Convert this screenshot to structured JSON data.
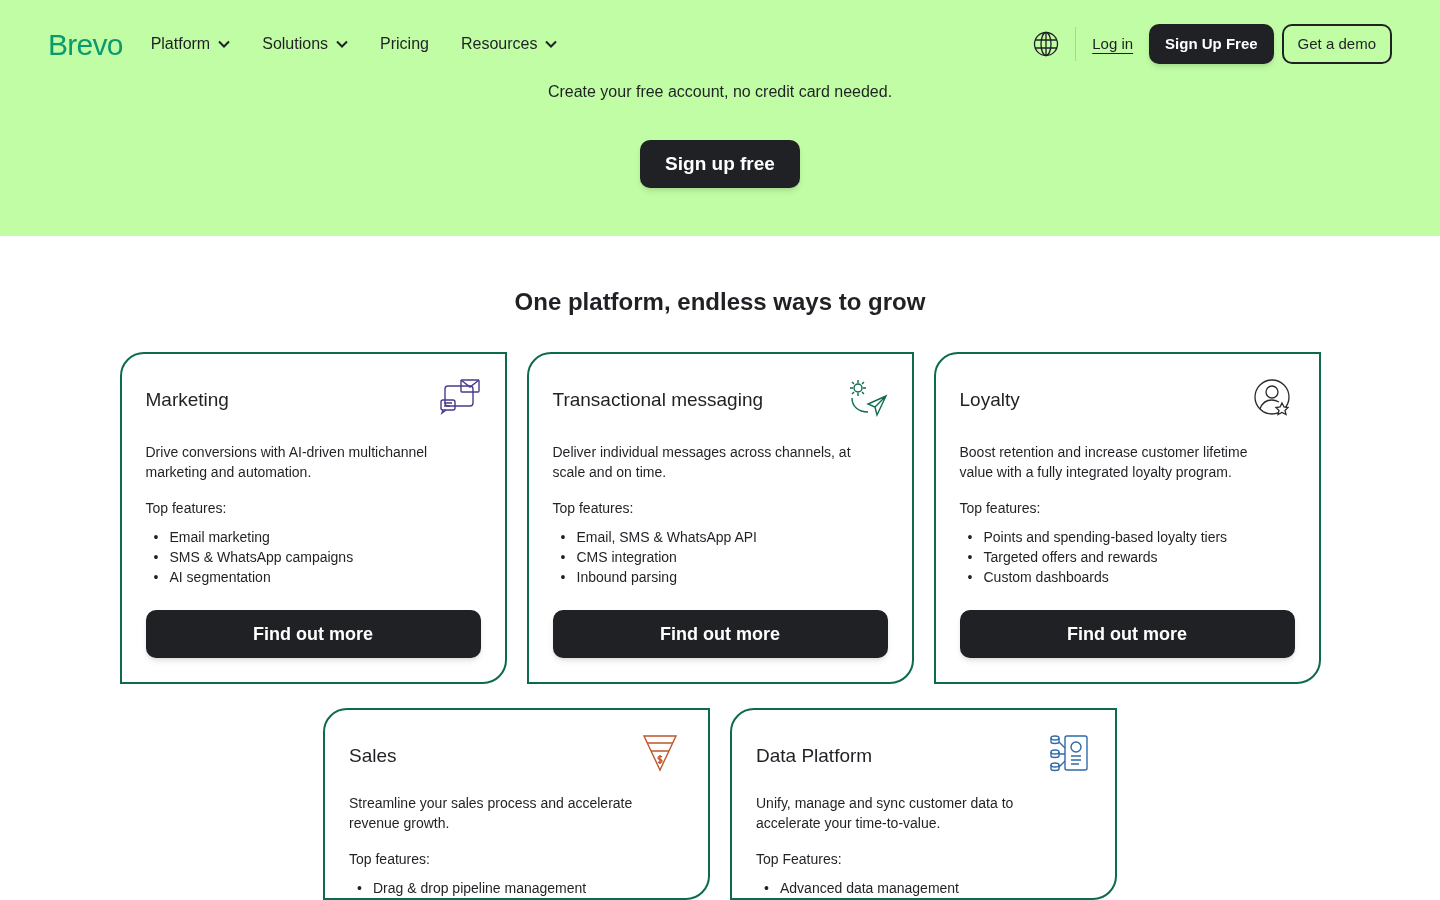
{
  "header": {
    "logo": "Brevo",
    "nav": [
      {
        "label": "Platform",
        "dropdown": true
      },
      {
        "label": "Solutions",
        "dropdown": true
      },
      {
        "label": "Pricing",
        "dropdown": false
      },
      {
        "label": "Resources",
        "dropdown": true
      }
    ],
    "login": "Log in",
    "signup": "Sign Up Free",
    "demo": "Get a demo"
  },
  "hero": {
    "subtitle": "Create your free account, no credit card needed.",
    "button": "Sign up free"
  },
  "section": {
    "title": "One platform, endless ways to grow"
  },
  "cards": [
    {
      "kind": "mail",
      "title": "Marketing",
      "description": "Drive conversions with AI-driven multichannel marketing and automation.",
      "features_label": "Top features:",
      "features": [
        {
          "bullet": "•",
          "text": "Email marketing"
        },
        {
          "bullet": "•",
          "text": "SMS & WhatsApp campaigns"
        },
        {
          "bullet": "•",
          "text": "AI segmentation"
        }
      ],
      "button": "Find out more"
    },
    {
      "kind": "send",
      "title": "Transactional messaging",
      "description": "Deliver individual messages across channels, at scale and on time.",
      "features_label": "Top features:",
      "features": [
        {
          "bullet": "•",
          "text": "Email, SMS & WhatsApp API"
        },
        {
          "bullet": "•",
          "text": "CMS integration"
        },
        {
          "bullet": "•",
          "text": "Inbound parsing"
        }
      ],
      "button": "Find out more"
    },
    {
      "kind": "user",
      "title": "Loyalty",
      "description": "Boost retention and increase customer lifetime value with a fully integrated loyalty program.",
      "features_label": "Top features:",
      "features": [
        {
          "bullet": "•",
          "text": "Points and spending-based loyalty tiers"
        },
        {
          "bullet": "•",
          "text": "Targeted offers and rewards"
        },
        {
          "bullet": "•",
          "text": "Custom dashboards"
        }
      ],
      "button": "Find out more"
    },
    {
      "kind": "funnel",
      "title": "Sales",
      "description": "Streamline your sales process and accelerate revenue growth.",
      "features_label": "Top features:",
      "features": [
        {
          "bullet": "•",
          "text": "Drag & drop pipeline management"
        }
      ]
    },
    {
      "kind": "data",
      "title": "Data Platform",
      "description": "Unify, manage and sync customer data to accelerate your time-to-value.",
      "features_label": "Top Features:",
      "features": [
        {
          "bullet": "•",
          "text": "Advanced data management"
        }
      ]
    }
  ]
}
